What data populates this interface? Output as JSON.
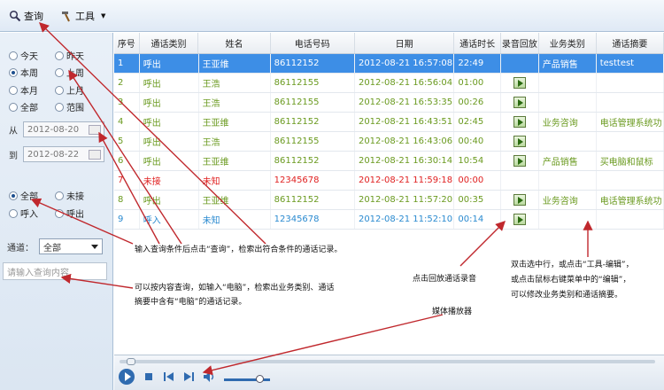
{
  "toolbar": {
    "query_label": "查询",
    "tools_label": "工具"
  },
  "left": {
    "range_options": [
      "今天",
      "昨天",
      "本周",
      "上周",
      "本月",
      "上月",
      "全部",
      "范围"
    ],
    "range_selected": "本周",
    "from_label": "从",
    "from_value": "2012-08-20",
    "to_label": "到",
    "to_value": "2012-08-22",
    "call_type_options": [
      "全部",
      "未接",
      "呼入",
      "呼出"
    ],
    "call_type_selected": "全部",
    "channel_label": "通道：",
    "channel_value": "全部",
    "search_placeholder": "请输入查询内容"
  },
  "grid": {
    "headers": [
      "序号",
      "通话类别",
      "姓名",
      "电话号码",
      "日期",
      "通话时长",
      "录音回放",
      "业务类别",
      "通话摘要"
    ],
    "rows": [
      {
        "no": "1",
        "type": "呼出",
        "name": "王亚维",
        "phone": "86112152",
        "date": "2012-08-21 16:57:08",
        "duration": "22:49",
        "biz": "产品销售",
        "summary": "testtest",
        "color": "#ffffff",
        "selected": true,
        "play": false
      },
      {
        "no": "2",
        "type": "呼出",
        "name": "王浩",
        "phone": "86112155",
        "date": "2012-08-21 16:56:04",
        "duration": "01:00",
        "biz": "",
        "summary": "",
        "color": "#6a9a1f",
        "selected": false,
        "play": true
      },
      {
        "no": "3",
        "type": "呼出",
        "name": "王浩",
        "phone": "86112155",
        "date": "2012-08-21 16:53:35",
        "duration": "00:26",
        "biz": "",
        "summary": "",
        "color": "#6a9a1f",
        "selected": false,
        "play": true
      },
      {
        "no": "4",
        "type": "呼出",
        "name": "王亚维",
        "phone": "86112152",
        "date": "2012-08-21 16:43:51",
        "duration": "02:45",
        "biz": "业务咨询",
        "summary": "电话管理系统功",
        "color": "#6a9a1f",
        "selected": false,
        "play": true
      },
      {
        "no": "5",
        "type": "呼出",
        "name": "王浩",
        "phone": "86112155",
        "date": "2012-08-21 16:43:06",
        "duration": "00:40",
        "biz": "",
        "summary": "",
        "color": "#6a9a1f",
        "selected": false,
        "play": true
      },
      {
        "no": "6",
        "type": "呼出",
        "name": "王亚维",
        "phone": "86112152",
        "date": "2012-08-21 16:30:14",
        "duration": "10:54",
        "biz": "产品销售",
        "summary": "买电脑和鼠标",
        "color": "#6a9a1f",
        "selected": false,
        "play": true
      },
      {
        "no": "7",
        "type": "未接",
        "name": "未知",
        "phone": "12345678",
        "date": "2012-08-21 11:59:18",
        "duration": "00:00",
        "biz": "",
        "summary": "",
        "color": "#e02020",
        "selected": false,
        "play": false
      },
      {
        "no": "8",
        "type": "呼出",
        "name": "王亚维",
        "phone": "86112152",
        "date": "2012-08-21 11:57:20",
        "duration": "00:35",
        "biz": "业务咨询",
        "summary": "电话管理系统功",
        "color": "#6a9a1f",
        "selected": false,
        "play": true
      },
      {
        "no": "9",
        "type": "呼入",
        "name": "未知",
        "phone": "12345678",
        "date": "2012-08-21 11:52:10",
        "duration": "00:14",
        "biz": "",
        "summary": "",
        "color": "#2a8ad0",
        "selected": false,
        "play": true
      }
    ]
  },
  "annotations": {
    "a1": "输入查询条件后点击“查询”，检索出符合条件的通话记录。",
    "a2_line1": "可以按内容查询，如输入“电脑”，检索出业务类别、通话",
    "a2_line2": "摘要中含有“电脑”的通话记录。",
    "a3": "点击回放通话录音",
    "a4_line1": "双击选中行，或点击“工具-编辑”，",
    "a4_line2": "或点击鼠标右键菜单中的“编辑”，",
    "a4_line3": "可以修改业务类别和通话摘要。",
    "a5": "媒体播放器"
  },
  "colors": {
    "selected_row": "#3d8ee6",
    "arrow": "#c0282d"
  }
}
